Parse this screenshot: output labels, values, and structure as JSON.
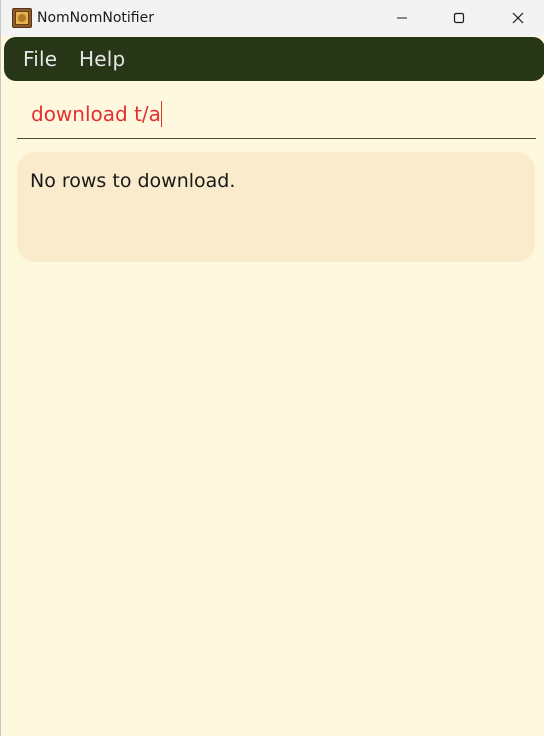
{
  "window": {
    "title": "NomNomNotifier",
    "icon": "app-logo-icon"
  },
  "window_controls": {
    "minimize_icon": "minimize-icon",
    "maximize_icon": "maximize-icon",
    "close_icon": "close-icon"
  },
  "menu": {
    "items": [
      {
        "label": "File"
      },
      {
        "label": "Help"
      }
    ]
  },
  "command": {
    "value": "download t/a"
  },
  "result": {
    "message": "No rows to download."
  },
  "colors": {
    "background": "#fef8df",
    "menubar": "#283618",
    "command_text": "#e53030",
    "result_background": "#f9ebcb"
  }
}
